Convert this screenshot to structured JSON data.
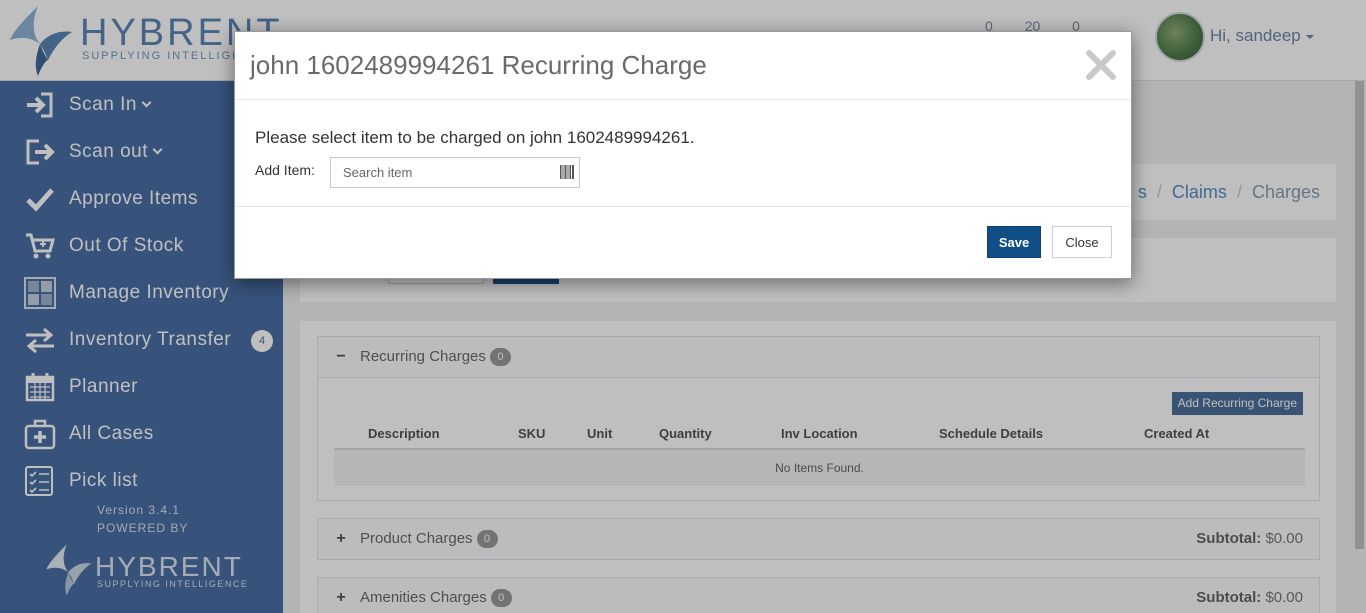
{
  "app": {
    "logo_word": "HYBRENT",
    "logo_tagline": "SUPPLYING INTELLIGENCE",
    "header_counters": [
      "0",
      "20",
      "0"
    ],
    "user_greeting": "Hi, sandeep"
  },
  "sidebar": {
    "items": [
      {
        "label": "Scan In",
        "icon": "scan-in-icon",
        "has_chevron": true
      },
      {
        "label": "Scan out",
        "icon": "scan-out-icon",
        "has_chevron": true
      },
      {
        "label": "Approve Items",
        "icon": "check-icon"
      },
      {
        "label": "Out Of Stock",
        "icon": "cart-icon"
      },
      {
        "label": "Manage Inventory",
        "icon": "inventory-icon"
      },
      {
        "label": "Inventory Transfer",
        "icon": "transfer-icon",
        "badge": "4"
      },
      {
        "label": "Planner",
        "icon": "calendar-icon"
      },
      {
        "label": "All Cases",
        "icon": "medical-case-icon"
      },
      {
        "label": "Pick list",
        "icon": "checklist-icon"
      }
    ],
    "version": "Version 3.4.1",
    "powered_by": "POWERED BY",
    "footer_logo_word": "HYBRENT",
    "footer_logo_tagline": "SUPPLYING INTELLIGENCE"
  },
  "breadcrumb": {
    "partial": "s",
    "claims": "Claims",
    "current": "Charges"
  },
  "recurring_panel": {
    "toggle": "−",
    "title": "Recurring Charges",
    "count": "0",
    "add_button": "Add Recurring Charge",
    "columns": [
      "Description",
      "SKU",
      "Unit",
      "Quantity",
      "Inv Location",
      "Schedule Details",
      "Created At"
    ],
    "empty_text": "No Items Found."
  },
  "product_panel": {
    "toggle": "+",
    "title": "Product Charges",
    "count": "0",
    "subtotal_label": "Subtotal:",
    "subtotal_value": "$0.00"
  },
  "amenities_panel": {
    "toggle": "+",
    "title": "Amenities Charges",
    "count": "0",
    "subtotal_label": "Subtotal:",
    "subtotal_value": "$0.00"
  },
  "modal": {
    "title": "john 1602489994261 Recurring Charge",
    "prompt": "Please select item to be charged on john 1602489994261.",
    "add_item_label": "Add Item:",
    "search_placeholder": "Search item",
    "search_value": "",
    "save_label": "Save",
    "close_label": "Close"
  },
  "colors": {
    "sidebar": "#4a6fa5",
    "primary_button": "#124e86",
    "link": "#5b8bc0"
  }
}
